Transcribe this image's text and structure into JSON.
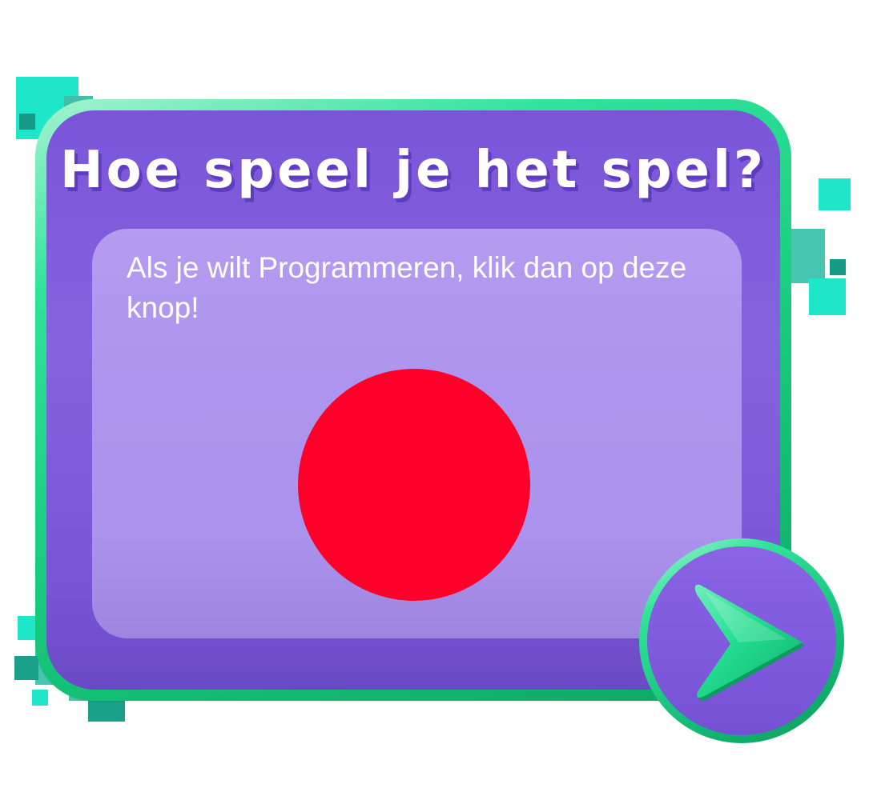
{
  "game": {
    "title": "Hoe speel je het spel?",
    "instruction": "Als je wilt Programmeren, klik dan op deze knop!"
  },
  "icons": {
    "record_button": "red-circle-button",
    "next_button": "arrow-right-icon"
  },
  "colors": {
    "frame_green": "#16c77c",
    "panel_purple": "#8563e0",
    "content_lavender": "#ae95ee",
    "button_red": "#ff002a",
    "arrow_green": "#1fd88a",
    "pixel_teal": "#1de3c4"
  }
}
